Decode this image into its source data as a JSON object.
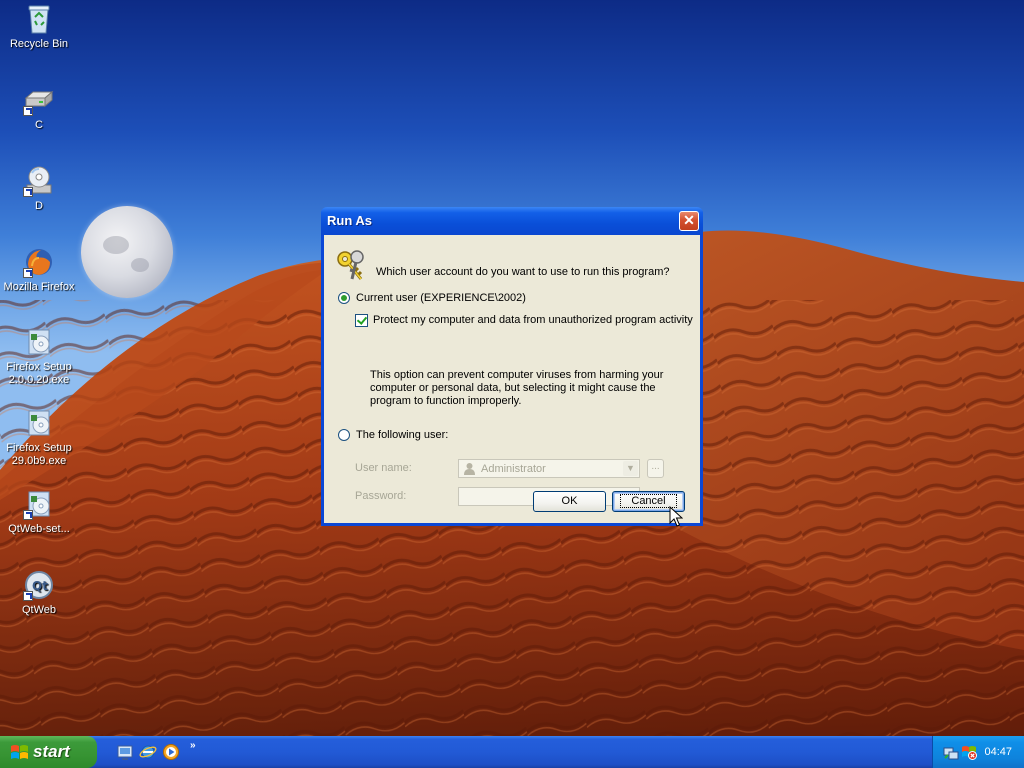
{
  "desktop": {
    "icons": [
      {
        "label": "Recycle Bin",
        "icon": "recycle-bin-icon"
      },
      {
        "label": "C",
        "icon": "drive-c-icon"
      },
      {
        "label": "D",
        "icon": "cd-drive-icon"
      },
      {
        "label": "Mozilla Firefox",
        "icon": "firefox-icon"
      },
      {
        "label": "Firefox Setup 2.0.0.20.exe",
        "icon": "installer-icon"
      },
      {
        "label": "Firefox Setup 29.0b9.exe",
        "icon": "installer-icon"
      },
      {
        "label": "QtWeb-set...",
        "icon": "installer-icon"
      },
      {
        "label": "QtWeb",
        "icon": "qtweb-icon"
      }
    ]
  },
  "dialog": {
    "title": "Run As",
    "close_label": "✕",
    "question": "Which user account do you want to use to run this program?",
    "current_user_label": "Current user (EXPERIENCE\\2002)",
    "current_user_selected": true,
    "protect_label": "Protect my computer and data from unauthorized program activity",
    "protect_checked": true,
    "description": "This option can prevent computer viruses from harming your computer or personal data, but selecting it might cause the program to function improperly.",
    "following_user_label": "The following user:",
    "following_user_selected": false,
    "username_label": "User name:",
    "username_value": "Administrator",
    "browse_label": "...",
    "password_label": "Password:",
    "password_value": "",
    "ok_label": "OK",
    "cancel_label": "Cancel"
  },
  "taskbar": {
    "start_label": "start",
    "quick_launch": [
      "show-desktop-icon",
      "internet-explorer-icon",
      "media-player-icon"
    ],
    "overflow_label": "»",
    "tray_icons": [
      "network-icon",
      "security-alert-icon"
    ],
    "clock": "04:47"
  },
  "colors": {
    "title_bar": "#0a47d6",
    "dialog_face": "#ece9d8",
    "start_button": "#3c9a3a",
    "close_button": "#d4512f",
    "taskbar": "#245edb"
  }
}
